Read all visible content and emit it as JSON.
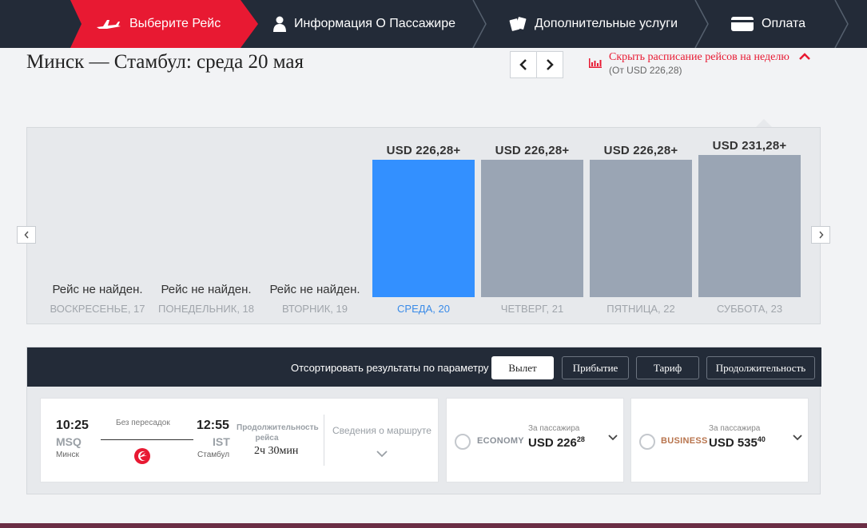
{
  "steps": [
    {
      "label": "Выберите Рейс",
      "icon": "plane-icon"
    },
    {
      "label": "Информация О Пассажире",
      "icon": "person-icon"
    },
    {
      "label": "Дополнительные услуги",
      "icon": "tickets-icon"
    },
    {
      "label": "Оплата",
      "icon": "card-icon"
    }
  ],
  "header": {
    "title": "Минск — Стамбул: среда 20 мая",
    "hide_schedule": "Скрыть расписание рейсов на неделю",
    "from_price": "(От USD 226,28)"
  },
  "week": [
    {
      "status": "Рейс не найден.",
      "price": "",
      "day": "ВОСКРЕСЕНЬЕ",
      "date": ", 17",
      "has_flight": false
    },
    {
      "status": "Рейс не найден.",
      "price": "",
      "day": "ПОНЕДЕЛЬНИК",
      "date": ", 18",
      "has_flight": false
    },
    {
      "status": "Рейс не найден.",
      "price": "",
      "day": "ВТОРНИК",
      "date": ", 19",
      "has_flight": false
    },
    {
      "status": "",
      "price": "USD 226,28+",
      "day": "СРЕДА",
      "date": ", 20",
      "has_flight": true,
      "selected": true,
      "value": 226.28
    },
    {
      "status": "",
      "price": "USD 226,28+",
      "day": "ЧЕТВЕРГ",
      "date": ", 21",
      "has_flight": true,
      "value": 226.28
    },
    {
      "status": "",
      "price": "USD 226,28+",
      "day": "ПЯТНИЦА",
      "date": ", 22",
      "has_flight": true,
      "value": 226.28
    },
    {
      "status": "",
      "price": "USD 231,28+",
      "day": "СУББОТА",
      "date": ", 23",
      "has_flight": true,
      "value": 231.28
    }
  ],
  "sort": {
    "label": "Отсортировать результаты по параметру",
    "options": [
      "Вылет",
      "Прибытие",
      "Тариф",
      "Продолжительность"
    ],
    "active": "Вылет"
  },
  "flight": {
    "dep_time": "10:25",
    "dep_code": "MSQ",
    "dep_city": "Минск",
    "stops": "Без пересадок",
    "arr_time": "12:55",
    "arr_code": "IST",
    "arr_city": "Стамбул",
    "duration_label": "Продолжительность рейса",
    "duration": "2ч 30мин",
    "route_details": "Сведения о маршруте"
  },
  "fares": [
    {
      "class": "ECONOMY",
      "per": "За пассажира",
      "price": "USD 226",
      "cents": "28",
      "color": "#8a9098"
    },
    {
      "class": "BUSINESS",
      "per": "За пассажира",
      "price": "USD 535",
      "cents": "40",
      "color": "#b8744d"
    }
  ],
  "colors": {
    "accent": "#e81932",
    "nav": "#232b38",
    "selected_bar": "#3390ff",
    "bar": "#9aa5b4"
  }
}
